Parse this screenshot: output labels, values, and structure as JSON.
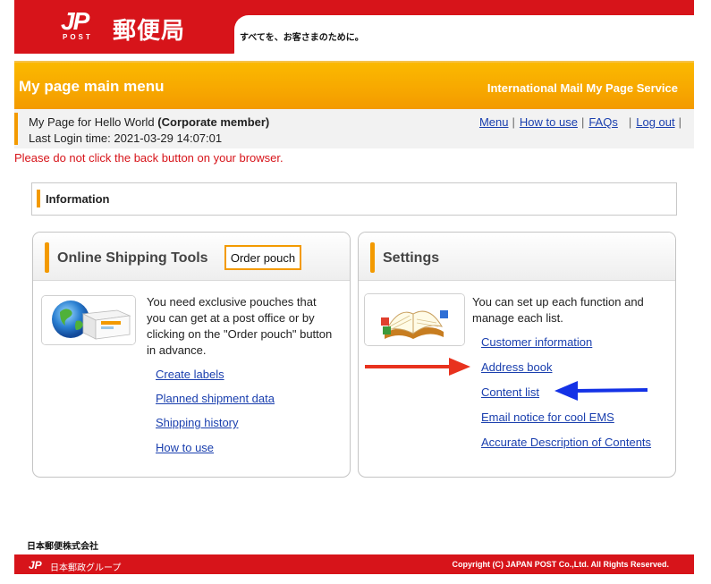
{
  "header": {
    "logo_mark": "JP",
    "logo_sub": "POST",
    "logo_text": "郵便局",
    "tagline": "すべてを、お客さまのために。"
  },
  "title_band": {
    "title": "My page main menu",
    "service": "International Mail My Page Service"
  },
  "user": {
    "line1_prefix": "My Page for Hello World",
    "member_type": "(Corporate member)",
    "last_login": "Last Login time: 2021-03-29 14:07:01"
  },
  "top_nav": {
    "menu": "Menu",
    "how_to_use": "How to use",
    "faqs": "FAQs",
    "log_out": "Log out",
    "separator": "|"
  },
  "warning": "Please do not click the back button on your browser.",
  "information": {
    "label": "Information"
  },
  "shipping_panel": {
    "title": "Online Shipping Tools",
    "order_button": "Order pouch",
    "description": "You need exclusive pouches that you can get at a post office or by clicking on the \"Order pouch\" button in advance.",
    "links": [
      "Create labels",
      "Planned shipment data",
      "Shipping history",
      "How to use"
    ]
  },
  "settings_panel": {
    "title": "Settings",
    "description": "You can set up each function and manage each list.",
    "links": [
      "Customer information",
      "Address book",
      "Content list",
      "Email notice for cool EMS",
      "Accurate Description of Contents"
    ]
  },
  "annotations": {
    "red_arrow_color": "#e8321e",
    "blue_arrow_color": "#1432e6"
  },
  "colors": {
    "brand_red": "#d7141a",
    "accent_orange": "#f39a00",
    "link_blue": "#1a3fae"
  },
  "footer": {
    "company": "日本郵便株式会社",
    "group_logo": "JP",
    "group_name": "日本郵政グループ",
    "copyright": "Copyright (C) JAPAN POST Co.,Ltd.  All Rights Reserved."
  }
}
